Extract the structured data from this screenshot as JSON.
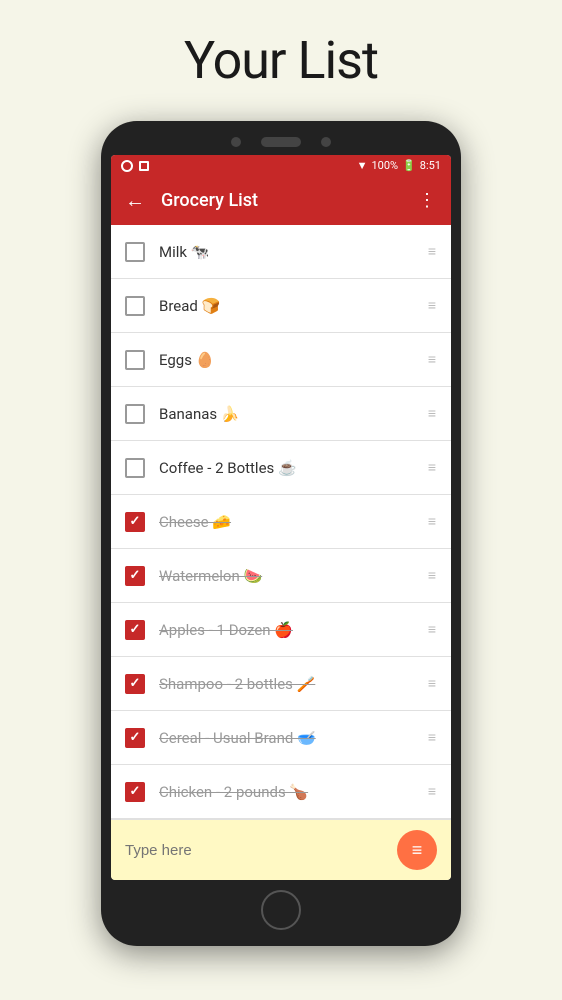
{
  "page": {
    "title": "Your List"
  },
  "statusBar": {
    "battery": "100%",
    "time": "8:51"
  },
  "appBar": {
    "title": "Grocery List"
  },
  "groceryItems": [
    {
      "id": 1,
      "text": "Milk 🐄",
      "checked": false
    },
    {
      "id": 2,
      "text": "Bread 🍞",
      "checked": false
    },
    {
      "id": 3,
      "text": "Eggs 🥚",
      "checked": false
    },
    {
      "id": 4,
      "text": "Bananas 🍌",
      "checked": false
    },
    {
      "id": 5,
      "text": "Coffee - 2 Bottles ☕",
      "checked": false
    },
    {
      "id": 6,
      "text": "Cheese 🧀",
      "checked": true
    },
    {
      "id": 7,
      "text": "Watermelon 🍉",
      "checked": true
    },
    {
      "id": 8,
      "text": "Apples - 1 Dozen 🍎",
      "checked": true
    },
    {
      "id": 9,
      "text": "Shampoo - 2 bottles 🪥",
      "checked": true
    },
    {
      "id": 10,
      "text": "Cereal - Usual Brand 🥣",
      "checked": true
    },
    {
      "id": 11,
      "text": "Chicken - 2 pounds 🍗",
      "checked": true
    }
  ],
  "input": {
    "placeholder": "Type here"
  },
  "dragHandleSymbol": "≡",
  "backArrow": "←",
  "menuDots": "⋮"
}
